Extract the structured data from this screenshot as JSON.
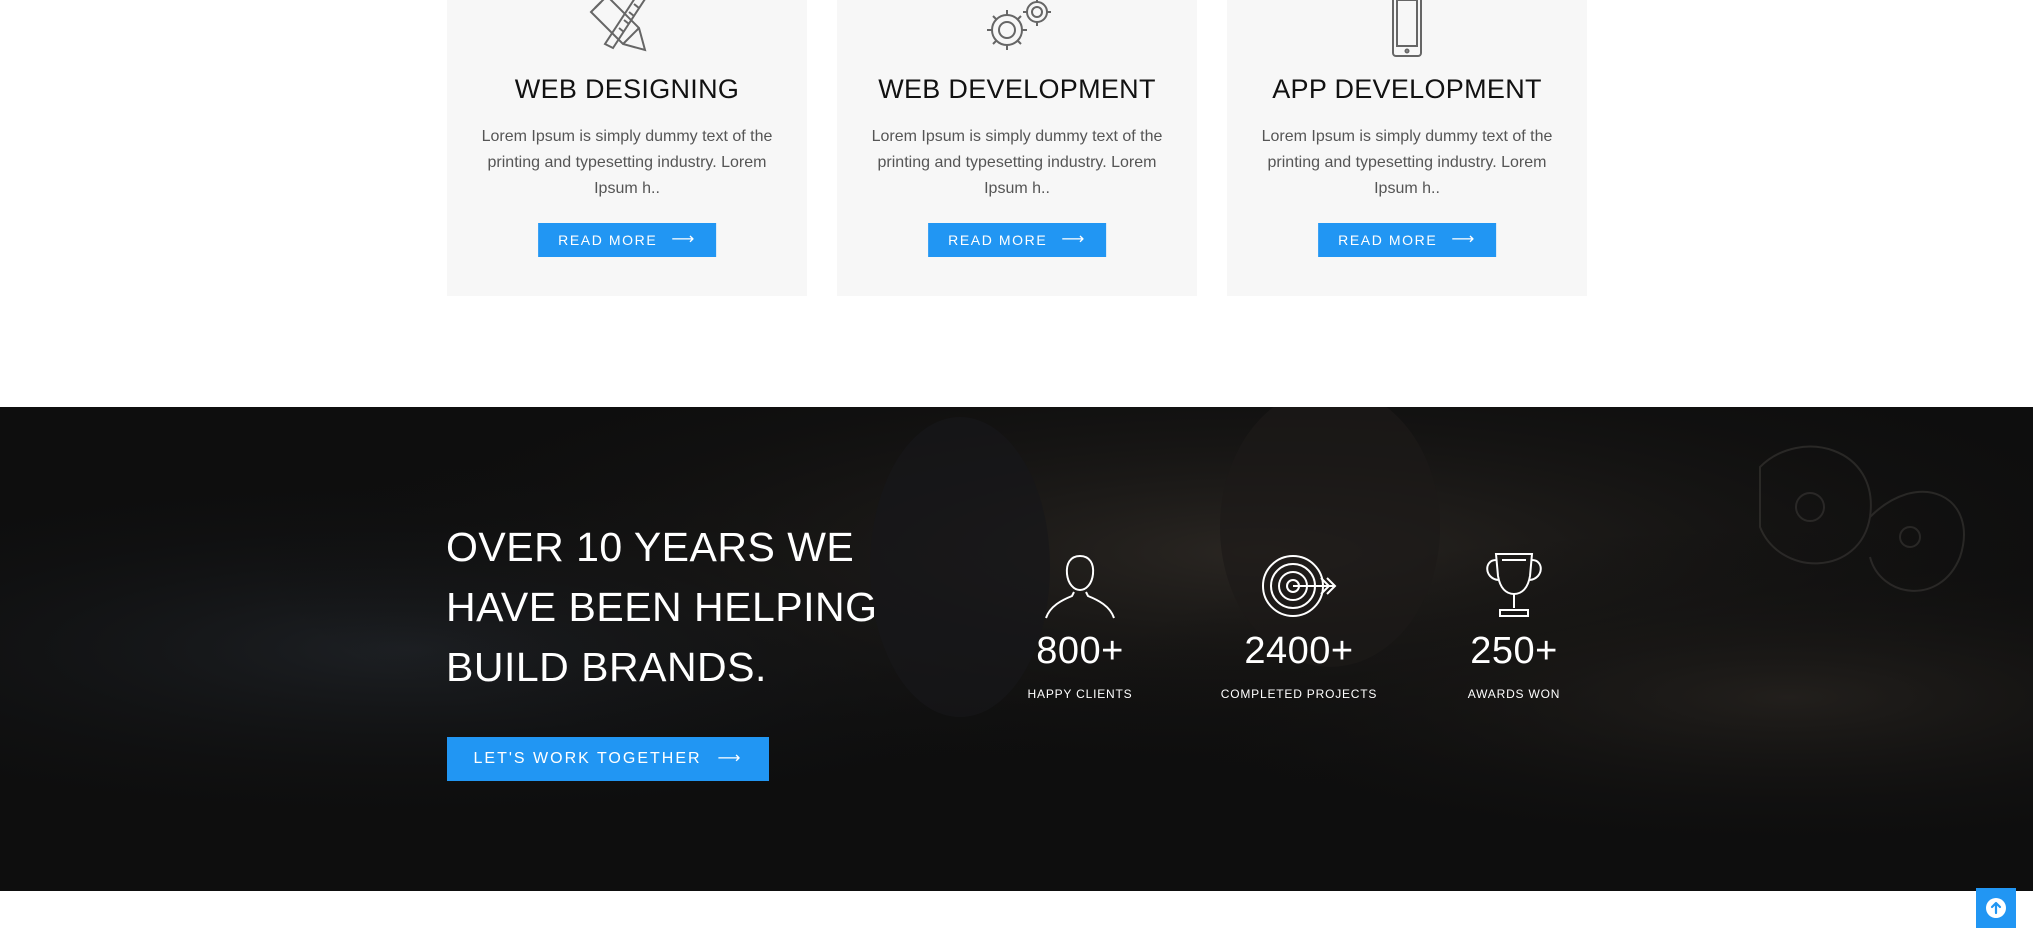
{
  "services": [
    {
      "icon": "pencil-ruler-icon",
      "title": "WEB DESIGNING",
      "text": "Lorem Ipsum is simply dummy text of the printing and typesetting industry. Lorem Ipsum h..",
      "button": "READ MORE"
    },
    {
      "icon": "gears-icon",
      "title": "WEB DEVELOPMENT",
      "text": "Lorem Ipsum is simply dummy text of the printing and typesetting industry. Lorem Ipsum h..",
      "button": "READ MORE"
    },
    {
      "icon": "tablet-icon",
      "title": "APP DEVELOPMENT",
      "text": "Lorem Ipsum is simply dummy text of the printing and typesetting industry. Lorem Ipsum h..",
      "button": "READ MORE"
    }
  ],
  "band": {
    "headline_lines": [
      "OVER 10 YEARS WE",
      "HAVE BEEN HELPING",
      "BUILD BRANDS."
    ],
    "cta": "LET'S WORK TOGETHER",
    "stats": [
      {
        "icon": "user-icon",
        "value": "800+",
        "label": "HAPPY CLIENTS"
      },
      {
        "icon": "target-icon",
        "value": "2400+",
        "label": "COMPLETED PROJECTS"
      },
      {
        "icon": "trophy-icon",
        "value": "250+",
        "label": "AWARDS WON"
      }
    ]
  },
  "colors": {
    "accent": "#2196f3",
    "card_bg": "#f7f7f7",
    "band_bg": "#0d0d0d"
  }
}
